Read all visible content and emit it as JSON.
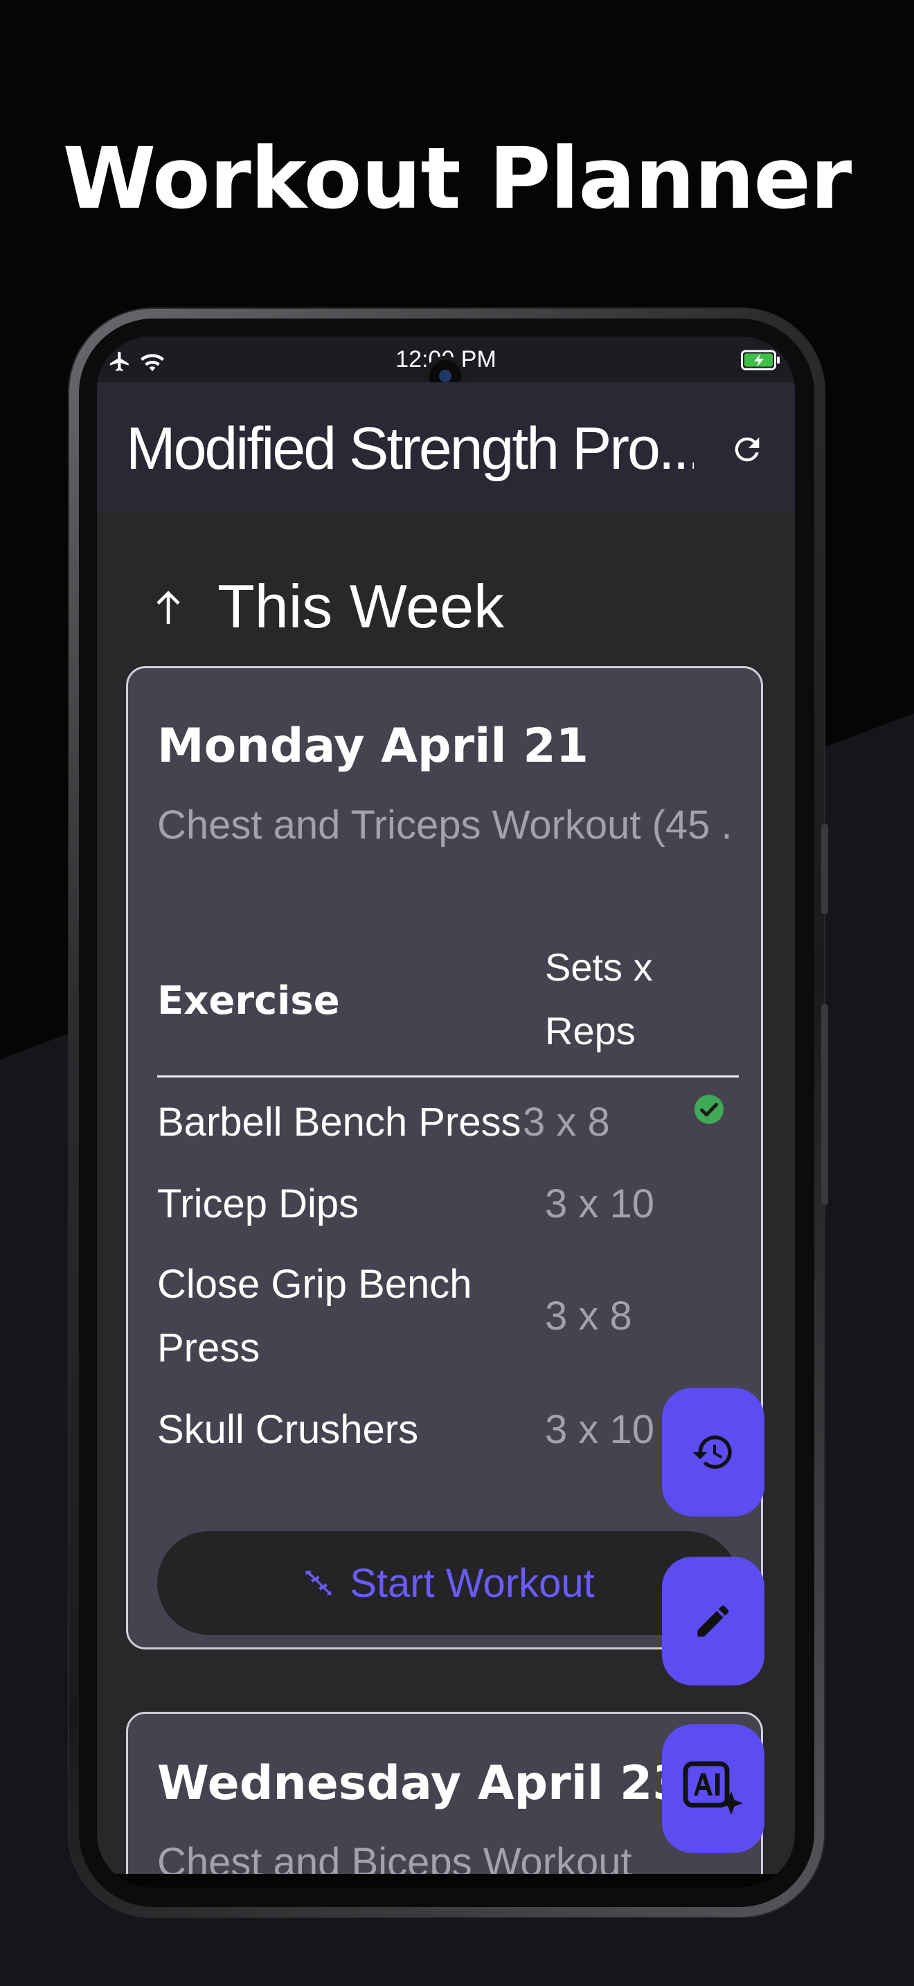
{
  "headline": "Workout Planner",
  "status_bar": {
    "time": "12:00 PM"
  },
  "app_bar": {
    "title": "Modified Strength Pro...",
    "refresh_icon": "refresh-icon"
  },
  "section": {
    "title": "This Week",
    "icon": "arrow-up-icon"
  },
  "cards": [
    {
      "day": "Monday April 21",
      "subtitle": "Chest and Triceps Workout (45 ...",
      "headers": {
        "exercise": "Exercise",
        "sets_line1": "Sets x",
        "sets_line2": "Reps"
      },
      "rows": [
        {
          "name": "Barbell Bench Press",
          "sets": "3 x 8",
          "done": true
        },
        {
          "name": "Tricep Dips",
          "sets": "3 x 10",
          "done": false
        },
        {
          "name_line1": "Close Grip Bench",
          "name_line2": "Press",
          "sets": "3 x 8",
          "done": false
        },
        {
          "name": "Skull Crushers",
          "sets": "3 x 10",
          "done": false
        }
      ],
      "start_label": "Start Workout"
    },
    {
      "day": "Wednesday April 23",
      "subtitle": "Chest and Biceps Workout"
    }
  ],
  "fabs": [
    {
      "icon": "history-icon"
    },
    {
      "icon": "edit-icon"
    },
    {
      "icon": "ai-sparkle-icon"
    }
  ],
  "colors": {
    "accent": "#5c4cf2",
    "accent_text": "#6a5cff",
    "check_green": "#3fa957",
    "card_bg": "#45434f",
    "appbar_bg": "#2a2834",
    "screen_bg": "#282729"
  }
}
